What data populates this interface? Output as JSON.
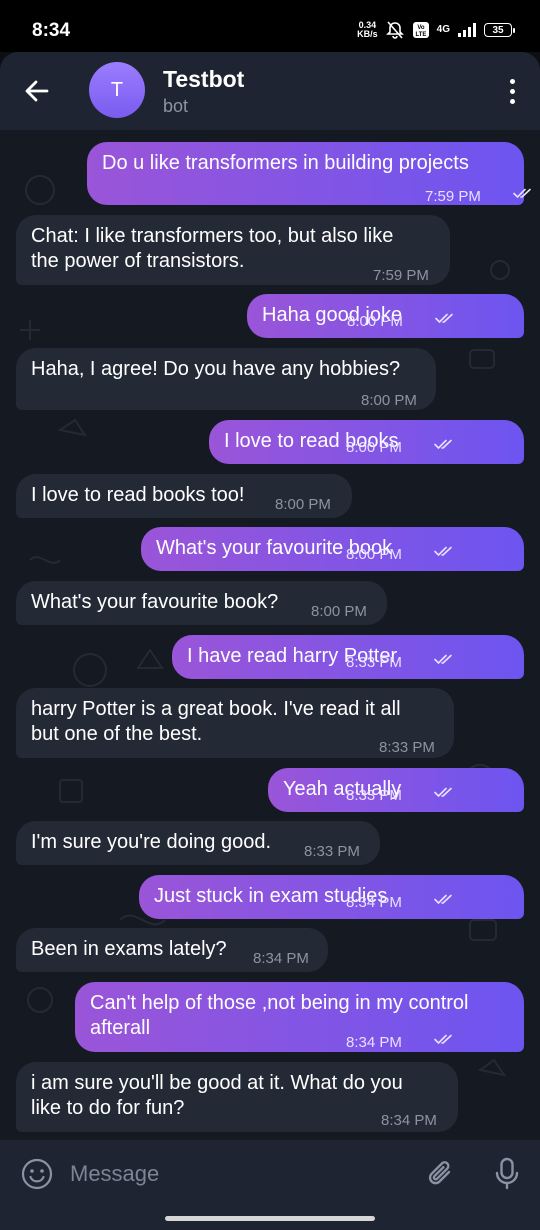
{
  "status_bar": {
    "time": "8:34",
    "net_speed_value": "0.34",
    "net_speed_unit": "KB/s",
    "volte": "Vo LTE",
    "network": "4G",
    "battery": "35"
  },
  "header": {
    "avatar_letter": "T",
    "name": "Testbot",
    "status": "bot"
  },
  "colors": {
    "outgoing_bubble_start": "#9a55d8",
    "outgoing_bubble_end": "#6d55f0",
    "incoming_bubble": "#232a36",
    "header_bg": "#1e2431",
    "chat_bg": "#141922"
  },
  "messages": [
    {
      "dir": "out",
      "text": "Do u like transformers in building projects",
      "time": "7:59 PM",
      "read": true
    },
    {
      "dir": "in",
      "text": "Chat: I like transformers too, but also like\nthe power of transistors.",
      "time": "7:59 PM"
    },
    {
      "dir": "out",
      "text": "Haha good joke",
      "time": "8:00 PM",
      "read": true
    },
    {
      "dir": "in",
      "text": "Haha, I agree! Do you have any hobbies?",
      "time": "8:00 PM"
    },
    {
      "dir": "out",
      "text": "I love to read books",
      "time": "8:00 PM",
      "read": true
    },
    {
      "dir": "in",
      "text": "I love to read books too!",
      "time": "8:00 PM"
    },
    {
      "dir": "out",
      "text": "What's your favourite book",
      "time": "8:00 PM",
      "read": true
    },
    {
      "dir": "in",
      "text": "What's your favourite book?",
      "time": "8:00 PM"
    },
    {
      "dir": "out",
      "text": "I have read harry Potter",
      "time": "8:33 PM",
      "read": true
    },
    {
      "dir": "in",
      "text": "harry Potter is a great book. I've read it all\nbut one of the best.",
      "time": "8:33 PM"
    },
    {
      "dir": "out",
      "text": "Yeah actually",
      "time": "8:33 PM",
      "read": true
    },
    {
      "dir": "in",
      "text": "I'm sure you're doing good.",
      "time": "8:33 PM"
    },
    {
      "dir": "out",
      "text": "Just stuck in exam studies",
      "time": "8:34 PM",
      "read": true
    },
    {
      "dir": "in",
      "text": "Been in exams lately?",
      "time": "8:34 PM"
    },
    {
      "dir": "out",
      "text": "Can't help of those ,not being in my control\nafterall",
      "time": "8:34 PM",
      "read": true
    },
    {
      "dir": "in",
      "text": "i am sure you'll be good at it. What do you\nlike to do for fun?",
      "time": "8:34 PM"
    }
  ],
  "input": {
    "placeholder": "Message",
    "emoji_icon": "emoji-icon",
    "attach_icon": "paperclip-icon",
    "mic_icon": "microphone-icon"
  }
}
